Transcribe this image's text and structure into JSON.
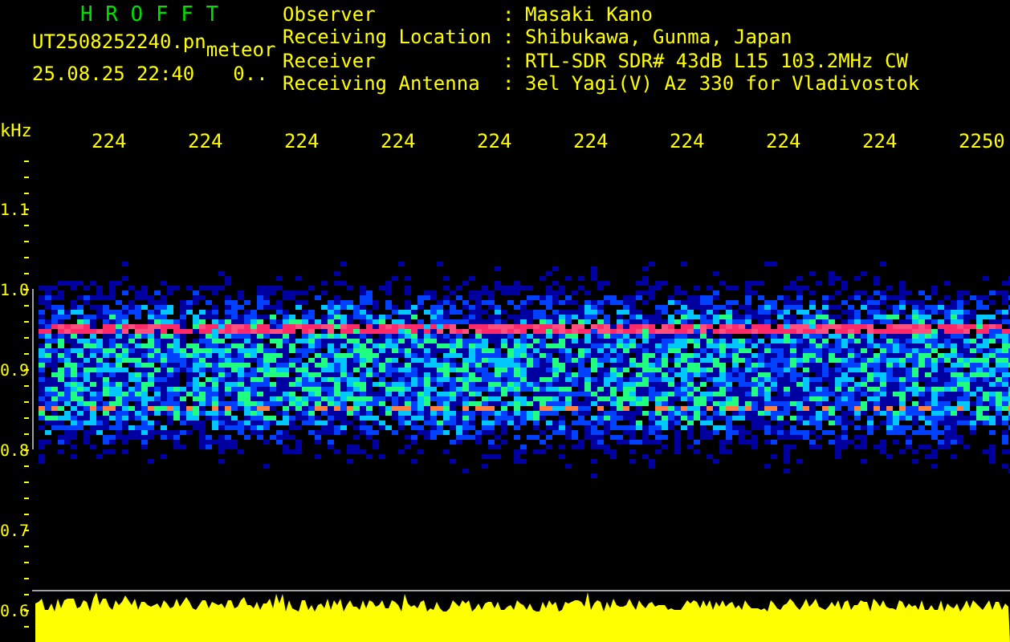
{
  "app_title": "H R O F F T",
  "file_name": "UT2508252240.pn",
  "mode": "meteor",
  "timestamp": "25.08.25 22:40",
  "counter": "0..",
  "info": [
    {
      "label": "Observer",
      "separator": ":",
      "value": "Masaki Kano"
    },
    {
      "label": "Receiving Location",
      "separator": ":",
      "value": "Shibukawa, Gunma, Japan"
    },
    {
      "label": "Receiver",
      "separator": ":",
      "value": "RTL-SDR SDR# 43dB L15 103.2MHz CW"
    },
    {
      "label": "Receiving Antenna",
      "separator": ":",
      "value": "3el Yagi(V) Az 330 for Vladivostok"
    }
  ],
  "axis": {
    "unit": "kHz",
    "x_labels": [
      "224",
      "224",
      "224",
      "224",
      "224",
      "224",
      "224",
      "224",
      "224",
      "2250"
    ],
    "y_labels": [
      "1.1",
      "1.0",
      "0.9",
      "0.8",
      "0.7",
      "0.6"
    ]
  }
}
